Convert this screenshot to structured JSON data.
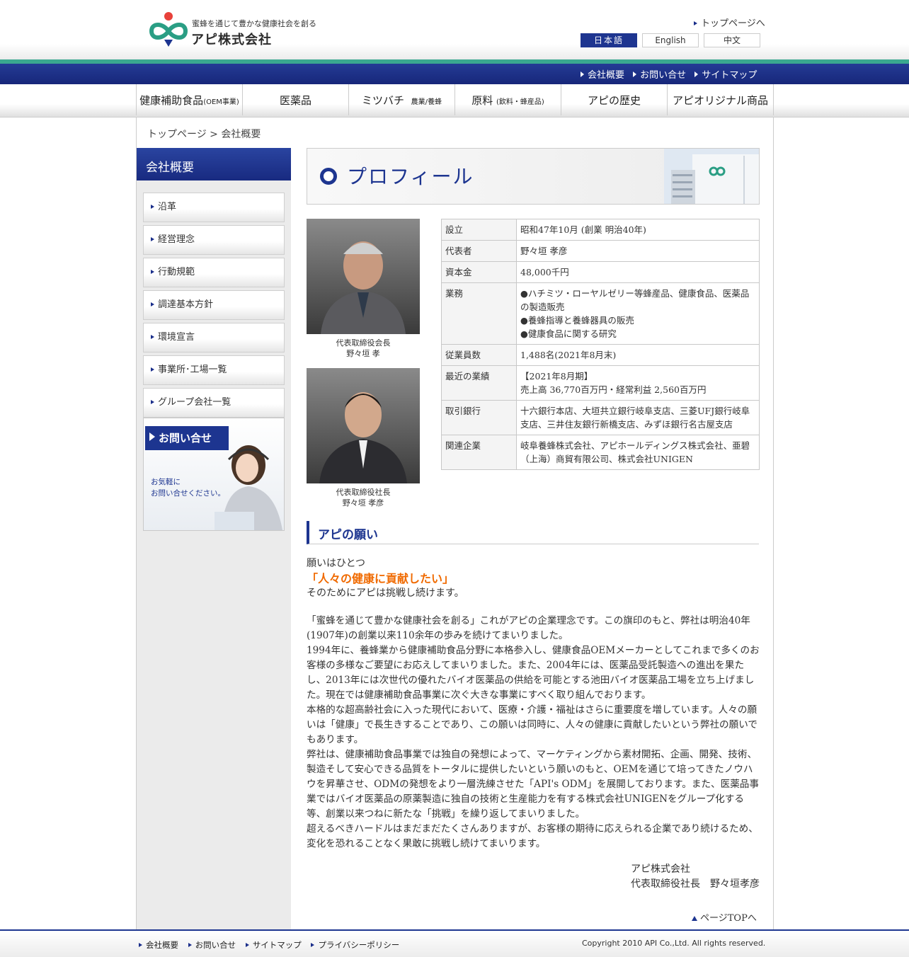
{
  "header": {
    "tagline": "蜜蜂を通じて豊かな健康社会を創る",
    "company_logo": "アピ株式会社",
    "top_link": "トップページへ",
    "languages": [
      "日本語",
      "English",
      "中文"
    ],
    "sub_links": [
      "会社概要",
      "お問い合せ",
      "サイトマップ"
    ]
  },
  "nav": [
    {
      "label": "健康補助食品",
      "sub": "(OEM事業)"
    },
    {
      "label": "医薬品",
      "sub": ""
    },
    {
      "label": "ミツバチ",
      "sub": "農業/養蜂"
    },
    {
      "label": "原料",
      "sub": "(飲料・蜂産品)"
    },
    {
      "label": "アピの歴史",
      "sub": ""
    },
    {
      "label": "アピオリジナル商品",
      "sub": ""
    }
  ],
  "breadcrumb": "トップページ > 会社概要",
  "sidebar": {
    "title": "会社概要",
    "items": [
      "沿革",
      "経営理念",
      "行動規範",
      "調達基本方針",
      "環境宣言",
      "事業所･工場一覧",
      "グループ会社一覧"
    ],
    "contact_button": "お問い合せ",
    "contact_text_1": "お気軽に",
    "contact_text_2": "お問い合せください。"
  },
  "profile": {
    "title": "プロフィール",
    "photo1_caption_1": "代表取締役会長",
    "photo1_caption_2": "野々垣 孝",
    "photo2_caption_1": "代表取締役社長",
    "photo2_caption_2": "野々垣 孝彦",
    "rows": [
      {
        "k": "設立",
        "v": [
          "昭和47年10月 (創業 明治40年)"
        ]
      },
      {
        "k": "代表者",
        "v": [
          "野々垣 孝彦"
        ]
      },
      {
        "k": "資本金",
        "v": [
          "48,000千円"
        ]
      },
      {
        "k": "業務",
        "v": [
          "●ハチミツ・ローヤルゼリー等蜂産品、健康食品、医薬品の製造販売",
          "●養蜂指導と養蜂器具の販売",
          "●健康食品に関する研究"
        ]
      },
      {
        "k": "従業員数",
        "v": [
          "1,488名(2021年8月末)"
        ]
      },
      {
        "k": "最近の業績",
        "v": [
          "【2021年8月期】",
          "売上高 36,770百万円・経常利益 2,560百万円"
        ]
      },
      {
        "k": "取引銀行",
        "v": [
          "十六銀行本店、大垣共立銀行岐阜支店、三菱UFJ銀行岐阜支店、三井住友銀行新橋支店、みずほ銀行名古屋支店"
        ]
      },
      {
        "k": "関連企業",
        "v": [
          "岐阜養蜂株式会社、アピホールディングス株式会社、亜碧（上海）商貿有限公司、株式会社UNIGEN"
        ]
      }
    ]
  },
  "wish": {
    "heading": "アピの願い",
    "line1": "願いはひとつ",
    "highlight": "「人々の健康に貢献したい」",
    "line2": "そのためにアピは挑戦し続けます。",
    "paragraphs": [
      "「蜜蜂を通じて豊かな健康社会を創る」これがアピの企業理念です。この旗印のもと、弊社は明治40年(1907年)の創業以来110余年の歩みを続けてまいりました。",
      "1994年に、養蜂業から健康補助食品分野に本格参入し、健康食品OEMメーカーとしてこれまで多くのお客様の多様なご要望にお応えしてまいりました。また、2004年には、医薬品受託製造への進出を果たし、2013年には次世代の優れたバイオ医薬品の供給を可能とする池田バイオ医薬品工場を立ち上げました。現在では健康補助食品事業に次ぐ大きな事業にすべく取り組んでおります。",
      "本格的な超高齢社会に入った現代において、医療・介護・福祉はさらに重要度を増しています。人々の願いは「健康」で長生きすることであり、この願いは同時に、人々の健康に貢献したいという弊社の願いでもあります。",
      "弊社は、健康補助食品事業では独自の発想によって、マーケティングから素材開拓、企画、開発、技術、製造そして安心できる品質をトータルに提供したいという願いのもと、OEMを通じて培ってきたノウハウを昇華させ、ODMの発想をより一層洗練させた「API's ODM」を展開しております。また、医薬品事業ではバイオ医薬品の原薬製造に独自の技術と生産能力を有する株式会社UNIGENをグループ化する等、創業以来つねに新たな「挑戦」を繰り返してまいりました。",
      "超えるべきハードルはまだまだたくさんありますが、お客様の期待に応えられる企業であり続けるため、変化を恐れることなく果敢に挑戦し続けてまいります。"
    ],
    "sign_company": "アピ株式会社",
    "sign_name": "代表取締役社長　野々垣孝彦"
  },
  "page_top": "ページTOPへ",
  "footer": {
    "links": [
      "会社概要",
      "お問い合せ",
      "サイトマップ",
      "プライバシーポリシー"
    ],
    "copyright": "Copyright 2010 API Co.,Ltd. All rights reserved."
  },
  "colors": {
    "brand_blue": "#1d3590",
    "accent_teal": "#3aa890",
    "highlight_orange": "#f06a00"
  }
}
